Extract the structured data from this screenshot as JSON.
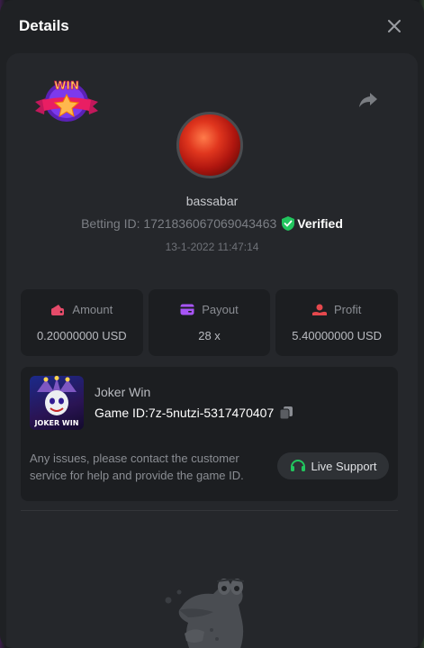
{
  "modal": {
    "title": "Details"
  },
  "user": {
    "name": "bassabar",
    "betting_id_label": "Betting ID: 1721836067069043463",
    "verified_label": "Verified",
    "timestamp": "13-1-2022 11:47:14"
  },
  "badge": {
    "text": "WIN"
  },
  "stats": [
    {
      "label": "Amount",
      "value": "0.20000000 USD",
      "icon": "wallet-icon",
      "color": "#e54b6a"
    },
    {
      "label": "Payout",
      "value": "28 x",
      "icon": "card-icon",
      "color": "#a855f7"
    },
    {
      "label": "Profit",
      "value": "5.40000000 USD",
      "icon": "hand-coin-icon",
      "color": "#e5484d"
    }
  ],
  "game": {
    "name": "Joker Win",
    "id_label": "Game ID:",
    "id_value": "7z-5nutzi-5317470407",
    "thumb_text": "JOKER WIN"
  },
  "support": {
    "message": "Any issues, please contact the customer service for help and provide the game ID.",
    "button_label": "Live Support"
  },
  "colors": {
    "verified": "#22c55e",
    "support_icon": "#22c55e"
  }
}
